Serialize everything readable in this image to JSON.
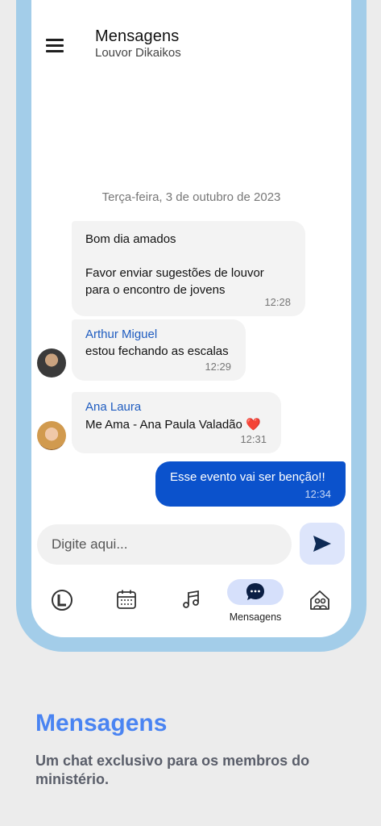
{
  "header": {
    "title": "Mensagens",
    "subtitle": "Louvor Dikaikos"
  },
  "date_separator": "Terça-feira, 3 de outubro de 2023",
  "messages": [
    {
      "line1": "Bom dia amados",
      "line2": "Favor enviar sugestões de louvor",
      "line3": "para o encontro de jovens",
      "time": "12:28"
    },
    {
      "sender": "Arthur Miguel",
      "text": "estou fechando as escalas",
      "time": "12:29"
    },
    {
      "sender": "Ana Laura",
      "text": "Me Ama - Ana Paula Valadão ❤️",
      "time": "12:31"
    },
    {
      "text": "Esse evento vai ser benção!!",
      "time": "12:34"
    }
  ],
  "composer": {
    "placeholder": "Digite aqui..."
  },
  "nav": {
    "active_label": "Mensagens"
  },
  "promo": {
    "title": "Mensagens",
    "description": "Um chat exclusivo para os membros do ministério."
  },
  "colors": {
    "accent": "#0b52cc",
    "frame": "#a3cde9",
    "promo_title": "#4a84f2",
    "active_nav": "#d6e0fb"
  }
}
